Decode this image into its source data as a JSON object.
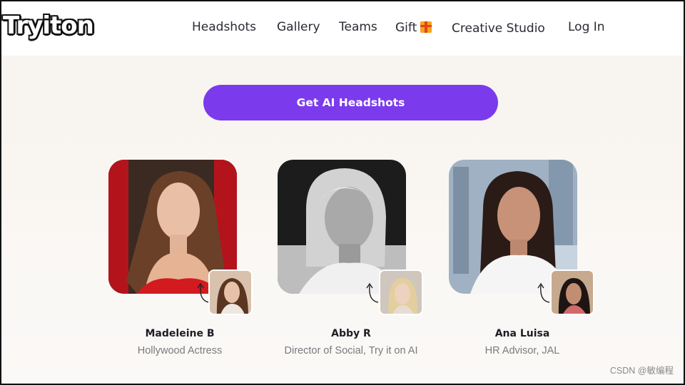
{
  "brand": {
    "logo_text": "Tryiton"
  },
  "nav": {
    "items": [
      {
        "label": "Headshots"
      },
      {
        "label": "Gallery"
      },
      {
        "label": "Teams"
      },
      {
        "label": "Gift"
      },
      {
        "label": "Creative Studio"
      },
      {
        "label": "Log In"
      }
    ]
  },
  "cta": {
    "label": "Get AI Headshots"
  },
  "testimonials": [
    {
      "name": "Madeleine B",
      "role": "Hollywood Actress"
    },
    {
      "name": "Abby R",
      "role": "Director of Social, Try it on AI"
    },
    {
      "name": "Ana Luisa",
      "role": "HR Advisor, JAL"
    }
  ],
  "watermark": "CSDN @敏编程",
  "colors": {
    "accent": "#7b3bec",
    "text_dark": "#2a2a33",
    "text_muted": "#7a7a80"
  }
}
